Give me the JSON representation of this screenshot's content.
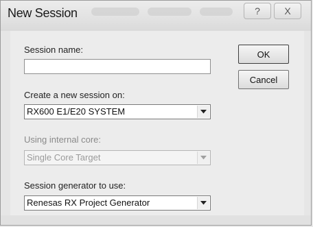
{
  "window": {
    "title": "New Session",
    "help_glyph": "?",
    "close_glyph": "X"
  },
  "fields": {
    "session_name_label": "Session name:",
    "session_name_value": "",
    "create_on_label": "Create a new session on:",
    "create_on_value": "RX600 E1/E20 SYSTEM",
    "internal_core_label": "Using internal core:",
    "internal_core_value": "Single Core Target",
    "generator_label": "Session generator to use:",
    "generator_value": "Renesas RX Project Generator"
  },
  "buttons": {
    "ok_label": "OK",
    "cancel_label": "Cancel"
  }
}
